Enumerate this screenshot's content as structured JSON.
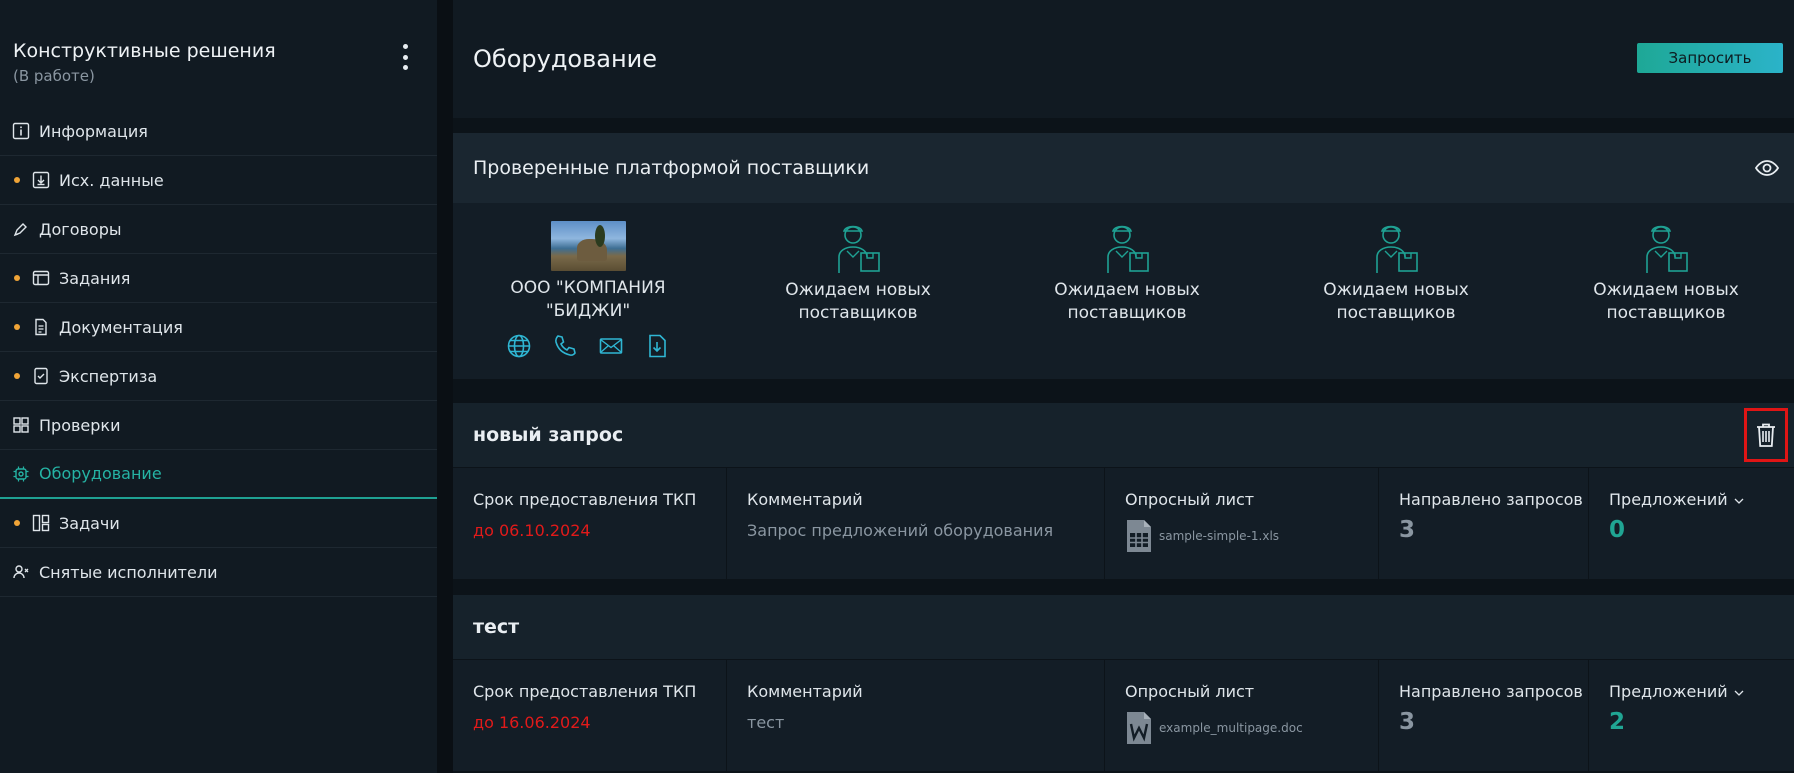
{
  "sidebar": {
    "title": "Конструктивные решения",
    "status": "(В работе)",
    "items": [
      {
        "label": "Информация",
        "dot": false,
        "icon": "info-icon"
      },
      {
        "label": "Исх. данные",
        "dot": true,
        "icon": "download-box-icon"
      },
      {
        "label": "Договоры",
        "dot": false,
        "icon": "pen-icon"
      },
      {
        "label": "Задания",
        "dot": true,
        "icon": "window-icon"
      },
      {
        "label": "Документация",
        "dot": true,
        "icon": "document-icon"
      },
      {
        "label": "Экспертиза",
        "dot": true,
        "icon": "checklist-icon"
      },
      {
        "label": "Проверки",
        "dot": false,
        "icon": "grid-icon"
      },
      {
        "label": "Оборудование",
        "dot": false,
        "icon": "chip-icon",
        "active": true
      },
      {
        "label": "Задачи",
        "dot": true,
        "icon": "kanban-icon"
      },
      {
        "label": "Снятые исполнители",
        "dot": false,
        "icon": "user-remove-icon"
      }
    ]
  },
  "page": {
    "title": "Оборудование",
    "request_button": "Запросить"
  },
  "suppliers": {
    "title": "Проверенные платформой поставщики",
    "items": [
      {
        "line1": "ООО \"КОМПАНИЯ",
        "line2": "\"БИДЖИ\""
      },
      {
        "line1": "Ожидаем новых",
        "line2": "поставщиков"
      },
      {
        "line1": "Ожидаем новых",
        "line2": "поставщиков"
      },
      {
        "line1": "Ожидаем новых",
        "line2": "поставщиков"
      },
      {
        "line1": "Ожидаем новых",
        "line2": "поставщиков"
      }
    ]
  },
  "requests": [
    {
      "title": "новый запрос",
      "deadline_label": "Срок предоставления ТКП",
      "deadline": "до 06.10.2024",
      "comment_label": "Комментарий",
      "comment": "Запрос предложений оборудования",
      "sheet_label": "Опросный лист",
      "file": "sample-simple-1.xls",
      "sent_label": "Направлено запросов",
      "sent": "3",
      "offers_label": "Предложений",
      "offers": "0"
    },
    {
      "title": "тест",
      "deadline_label": "Срок предоставления ТКП",
      "deadline": "до 16.06.2024",
      "comment_label": "Комментарий",
      "comment": "тест",
      "sheet_label": "Опросный лист",
      "file": "example_multipage.doc",
      "sent_label": "Направлено запросов",
      "sent": "3",
      "offers_label": "Предложений",
      "offers": "2"
    }
  ],
  "colors": {
    "accent": "#20a593",
    "deadline": "#e11a1a",
    "dot": "#f0a437"
  }
}
